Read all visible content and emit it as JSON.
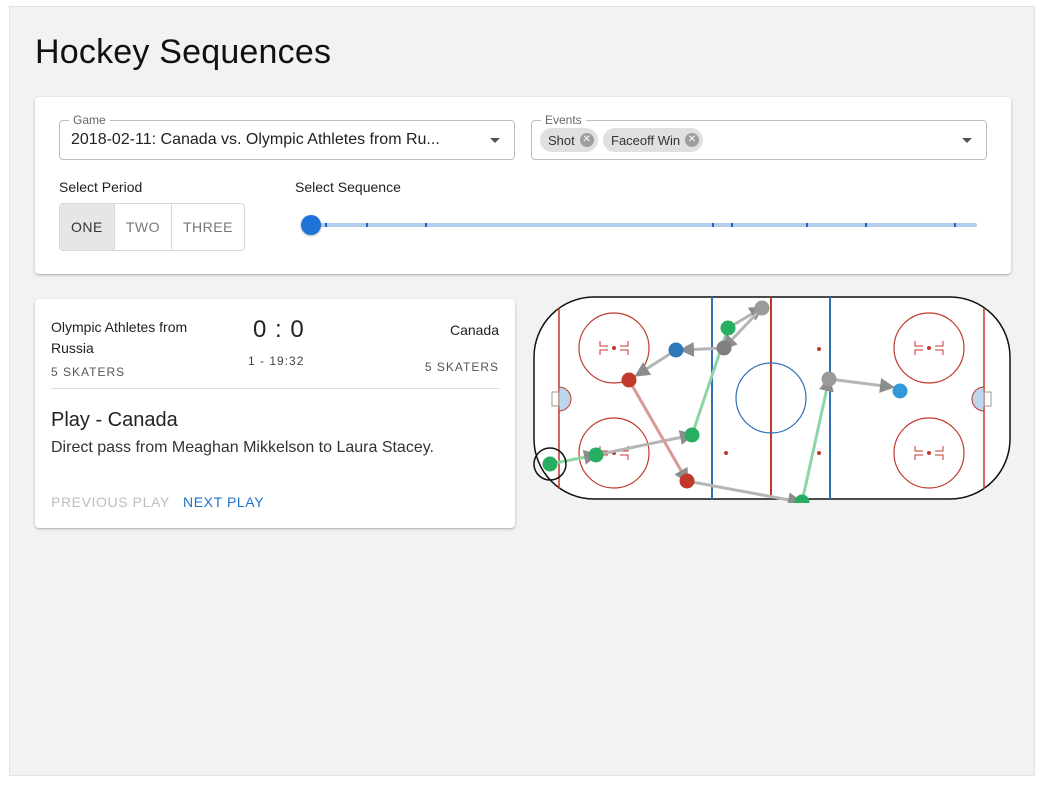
{
  "page_title": "Hockey Sequences",
  "filters": {
    "game": {
      "label": "Game",
      "value": "2018-02-11: Canada vs. Olympic Athletes from Ru..."
    },
    "events": {
      "label": "Events",
      "chips": [
        "Shot",
        "Faceoff Win"
      ]
    },
    "period": {
      "label": "Select Period",
      "options": [
        "ONE",
        "TWO",
        "THREE"
      ],
      "selected": "ONE"
    },
    "sequence": {
      "label": "Select Sequence",
      "value": 0
    }
  },
  "play": {
    "away_team": "Olympic Athletes from Russia",
    "home_team": "Canada",
    "away_skaters": "5 SKATERS",
    "home_skaters": "5 SKATERS",
    "score": "0 : 0",
    "time": "1 - 19:32",
    "title": "Play - Canada",
    "description": "Direct pass from Meaghan Mikkelson to Laura Stacey.",
    "prev_label": "PREVIOUS PLAY",
    "next_label": "NEXT PLAY"
  },
  "colors": {
    "accent": "#1e73d9",
    "green": "#27ae60",
    "red": "#c0392b",
    "gray": "#8d8d8d",
    "blue": "#2e86c1",
    "light_blue": "#3498db"
  }
}
